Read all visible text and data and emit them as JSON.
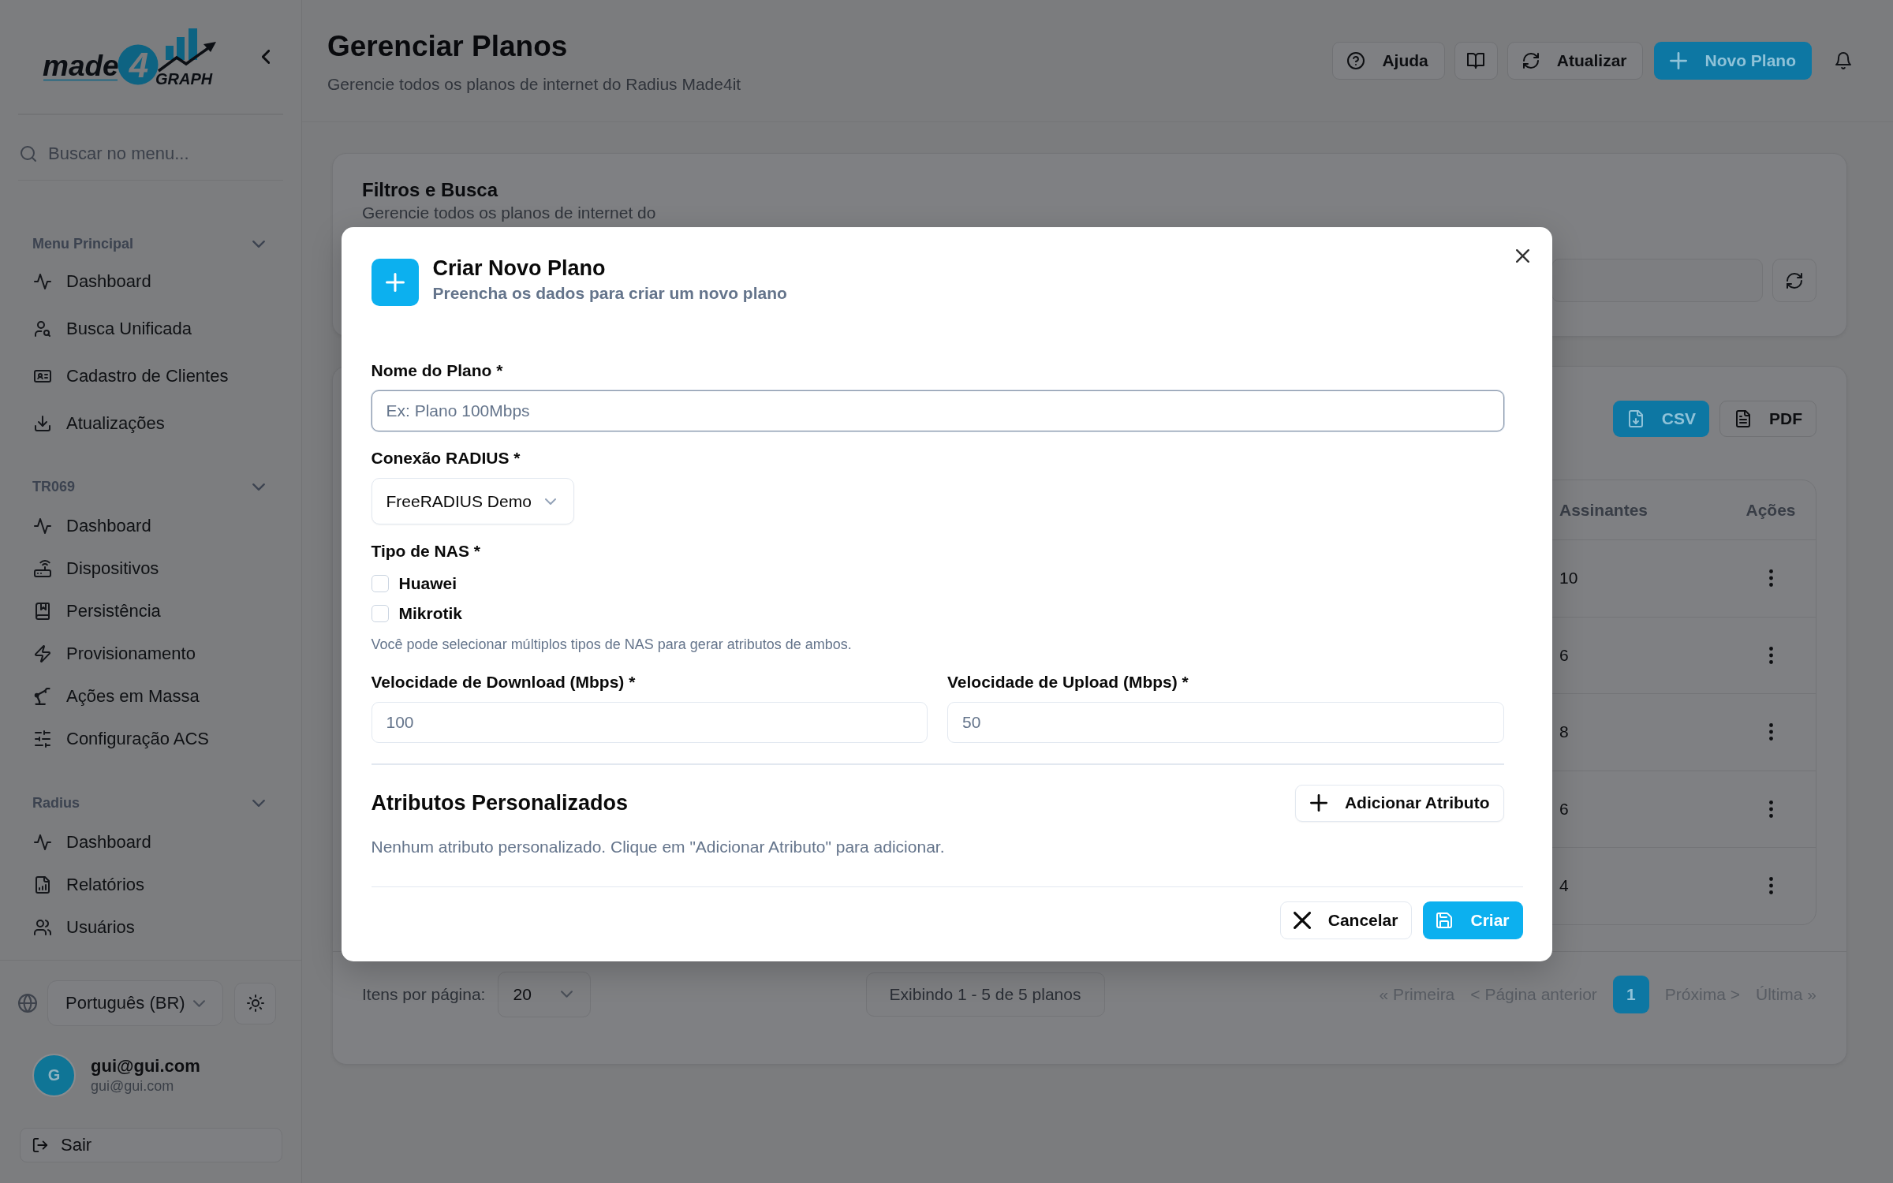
{
  "sidebar": {
    "logo": {
      "word": "made",
      "digit": "4",
      "tail": "GRAPH"
    },
    "search": {
      "placeholder": "Buscar no menu..."
    },
    "groups": [
      {
        "title": "Menu Principal",
        "expanded": true,
        "items": [
          {
            "label": "Dashboard",
            "selected": false
          },
          {
            "label": "Busca Unificada",
            "selected": false
          },
          {
            "label": "Cadastro de Clientes",
            "selected": false
          },
          {
            "label": "Atualizações",
            "selected": false
          }
        ]
      },
      {
        "title": "TR069",
        "expanded": true,
        "items": [
          {
            "label": "Dashboard",
            "selected": false
          },
          {
            "label": "Dispositivos",
            "selected": false
          },
          {
            "label": "Persistência",
            "selected": false
          },
          {
            "label": "Provisionamento",
            "selected": false
          },
          {
            "label": "Ações em Massa",
            "selected": false
          },
          {
            "label": "Configuração ACS",
            "selected": false
          }
        ]
      },
      {
        "title": "Radius",
        "expanded": true,
        "items": [
          {
            "label": "Dashboard",
            "selected": false
          },
          {
            "label": "Relatórios",
            "selected": false
          },
          {
            "label": "Usuários",
            "selected": false
          }
        ]
      }
    ],
    "language": {
      "value": "Português (BR)"
    },
    "user": {
      "initial": "G",
      "name": "gui@gui.com",
      "email": "gui@gui.com"
    },
    "logout": {
      "label": "Sair"
    }
  },
  "header": {
    "title": "Gerenciar Planos",
    "subtitle": "Gerencie todos os planos de internet do Radius Made4it",
    "buttons": [
      {
        "kind": "outline",
        "label": "Ajuda"
      },
      {
        "kind": "icon"
      },
      {
        "kind": "outline",
        "label": "Atualizar"
      },
      {
        "kind": "primary",
        "label": "Novo Plano"
      }
    ]
  },
  "filters": {
    "title": "Filtros e Busca",
    "subtitle": "Gerencie todos os planos de internet do"
  },
  "plans": {
    "export_buttons": [
      {
        "kind": "primary",
        "label": "CSV"
      },
      {
        "kind": "outline",
        "label": "PDF"
      }
    ],
    "table": {
      "columns": [
        "Assinantes",
        "Ações"
      ],
      "rows": [
        {
          "cells": [
            "10"
          ]
        },
        {
          "cells": [
            "6"
          ]
        },
        {
          "cells": [
            "8"
          ]
        },
        {
          "cells": [
            "6"
          ]
        },
        {
          "cells": [
            "4"
          ]
        }
      ]
    },
    "pagination": {
      "per_page_label": "Itens por página:",
      "per_page": "20",
      "summary": "Exibindo 1 - 5 de 5 planos",
      "links": [
        {
          "kind": "link",
          "label": "« Primeira",
          "disabled": true,
          "selected": false
        },
        {
          "kind": "link",
          "label": "< Página anterior",
          "disabled": true,
          "selected": false
        },
        {
          "kind": "page",
          "label": "1",
          "disabled": false,
          "selected": true
        },
        {
          "kind": "link",
          "label": "Próxima >",
          "disabled": true,
          "selected": false
        },
        {
          "kind": "link",
          "label": "Última »",
          "disabled": true,
          "selected": false
        }
      ]
    }
  },
  "dialog": {
    "title": "Criar Novo Plano",
    "subtitle": "Preencha os dados para criar um novo plano",
    "fields": [
      {
        "kind": "text",
        "label": "Nome do Plano *",
        "placeholder": "Ex: Plano 100Mbps",
        "focused": true
      },
      {
        "kind": "select",
        "label": "Conexão RADIUS *",
        "value": "FreeRADIUS Demo"
      },
      {
        "kind": "checks",
        "label": "Tipo de NAS *",
        "options": [
          {
            "label": "Huawei",
            "checked": false
          },
          {
            "label": "Mikrotik",
            "checked": false
          }
        ],
        "help": "Você pode selecionar múltiplos tipos de NAS para gerar atributos de ambos."
      },
      {
        "kind": "pair",
        "fields": [
          {
            "label": "Velocidade de Download (Mbps) *",
            "placeholder": "100",
            "focused": false
          },
          {
            "label": "Velocidade de Upload (Mbps) *",
            "placeholder": "50",
            "focused": false
          }
        ]
      }
    ],
    "attributes": {
      "title": "Atributos Personalizados",
      "add_label": "Adicionar Atributo",
      "empty": "Nenhum atributo personalizado. Clique em \"Adicionar Atributo\" para adicionar."
    },
    "buttons": [
      {
        "kind": "outline",
        "label": "Cancelar"
      },
      {
        "kind": "primary",
        "label": "Criar"
      }
    ]
  }
}
